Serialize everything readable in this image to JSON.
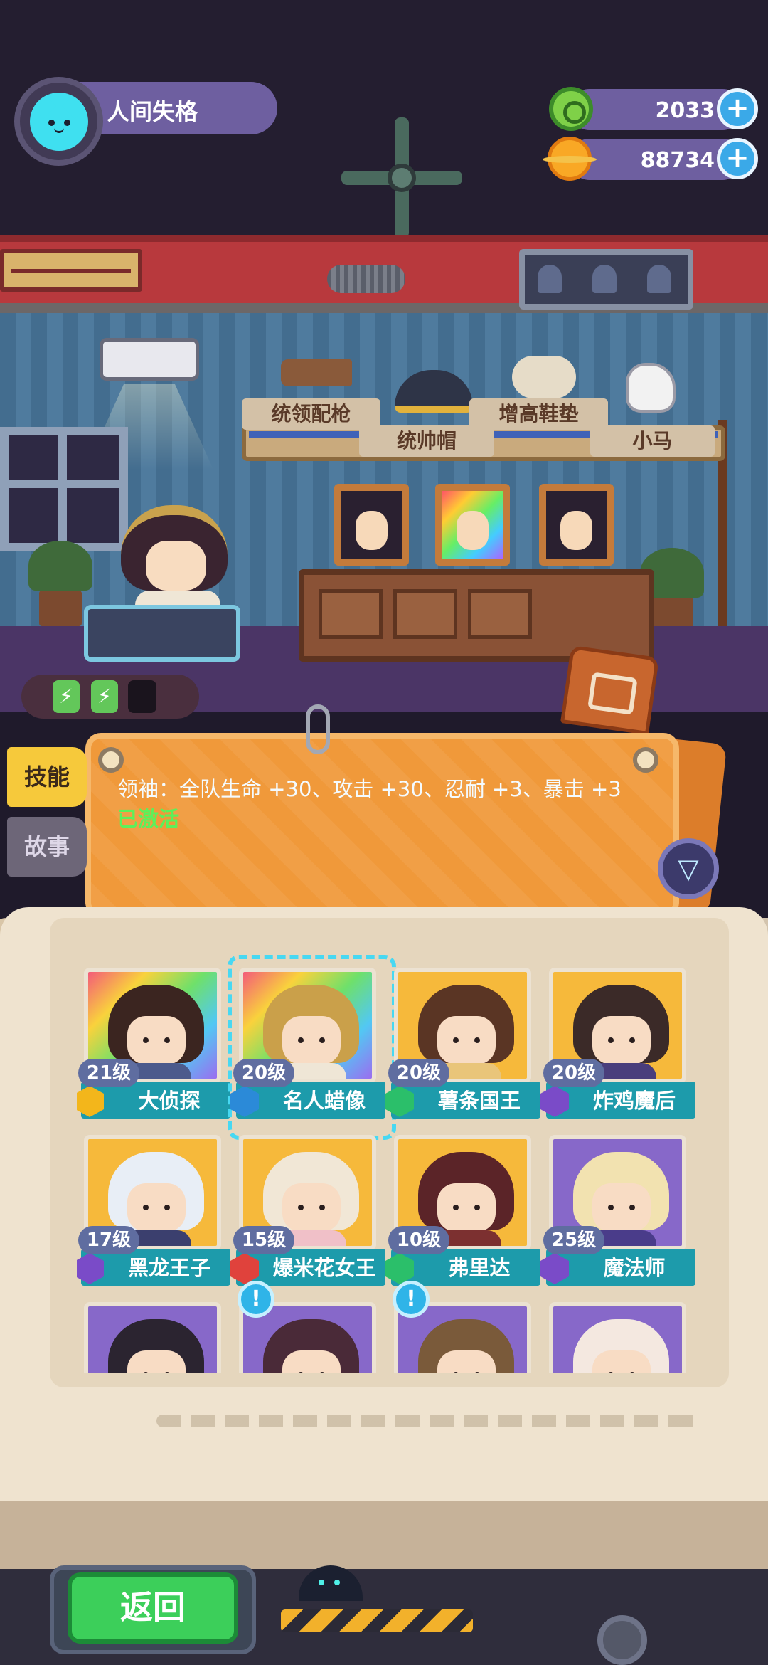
{
  "player": {
    "name": "人间失格",
    "avatar_icon": "cyan-cat-avatar"
  },
  "currencies": [
    {
      "name": "green-gem",
      "value": "2033",
      "icon": "green-coin-icon"
    },
    {
      "name": "gold-planet-coin",
      "value": "88734",
      "icon": "gold-planet-icon"
    }
  ],
  "plus_symbol": "+",
  "shelf_items": [
    {
      "label": "统领配枪"
    },
    {
      "label": "统帅帽"
    },
    {
      "label": "增高鞋垫"
    },
    {
      "label": "小马"
    }
  ],
  "energy": {
    "full": 2,
    "battery_symbol": "⚡"
  },
  "side_tabs": {
    "skill": "技能",
    "story": "故事"
  },
  "info": {
    "description": "领袖：全队生命 +30、攻击 +30、忍耐 +3、暴击 +3",
    "status": "已激活"
  },
  "filter_symbol": "▽",
  "characters": [
    {
      "level": "21级",
      "name": "大侦探",
      "frame": "rainbow",
      "badge": "gold",
      "hair": "#3b2520",
      "body": "#4c5a8c",
      "alert": false,
      "selected": false
    },
    {
      "level": "20级",
      "name": "名人蜡像",
      "frame": "rainbow",
      "badge": "blue",
      "hair": "#caa04a",
      "body": "#efe6d6",
      "alert": false,
      "selected": true
    },
    {
      "level": "20级",
      "name": "薯条国王",
      "frame": "gold",
      "badge": "green",
      "hair": "#5a3524",
      "body": "#e9c57a",
      "alert": false,
      "selected": false
    },
    {
      "level": "20级",
      "name": "炸鸡魔后",
      "frame": "gold",
      "badge": "purple",
      "hair": "#3b2a28",
      "body": "#4a3e7c",
      "alert": false,
      "selected": false
    },
    {
      "level": "17级",
      "name": "黑龙王子",
      "frame": "gold",
      "badge": "purple",
      "hair": "#e8eef6",
      "body": "#3b3f6e",
      "alert": false,
      "selected": false
    },
    {
      "level": "15级",
      "name": "爆米花女王",
      "frame": "gold",
      "badge": "red",
      "hair": "#f1e7d6",
      "body": "#f0c0c8",
      "alert": false,
      "selected": false
    },
    {
      "level": "10级",
      "name": "弗里达",
      "frame": "gold",
      "badge": "green",
      "hair": "#5b2428",
      "body": "#7c3030",
      "alert": false,
      "selected": false
    },
    {
      "level": "25级",
      "name": "魔法师",
      "frame": "purple",
      "badge": "purple",
      "hair": "#f2e2b0",
      "body": "#4a3c8a",
      "alert": false,
      "selected": false
    },
    {
      "level": "",
      "name": "",
      "frame": "purple",
      "badge": "",
      "hair": "#2b2430",
      "body": "#3a3244",
      "alert": false,
      "selected": false
    },
    {
      "level": "",
      "name": "",
      "frame": "purple",
      "badge": "",
      "hair": "#4a2a38",
      "body": "#3a3244",
      "alert": true,
      "selected": false
    },
    {
      "level": "",
      "name": "",
      "frame": "purple",
      "badge": "",
      "hair": "#7a5a3a",
      "body": "#3a3244",
      "alert": true,
      "selected": false
    },
    {
      "level": "",
      "name": "",
      "frame": "purple",
      "badge": "",
      "hair": "#f4e8e0",
      "body": "#3a3244",
      "alert": false,
      "selected": false
    }
  ],
  "alert_symbol": "!",
  "back_button": "返回",
  "colors": {
    "accent_teal": "#1d9bab",
    "button_green": "#3ccf5a",
    "board_orange": "#f0993a",
    "active_green": "#5df05a",
    "hud_purple": "#6e5fa0"
  }
}
